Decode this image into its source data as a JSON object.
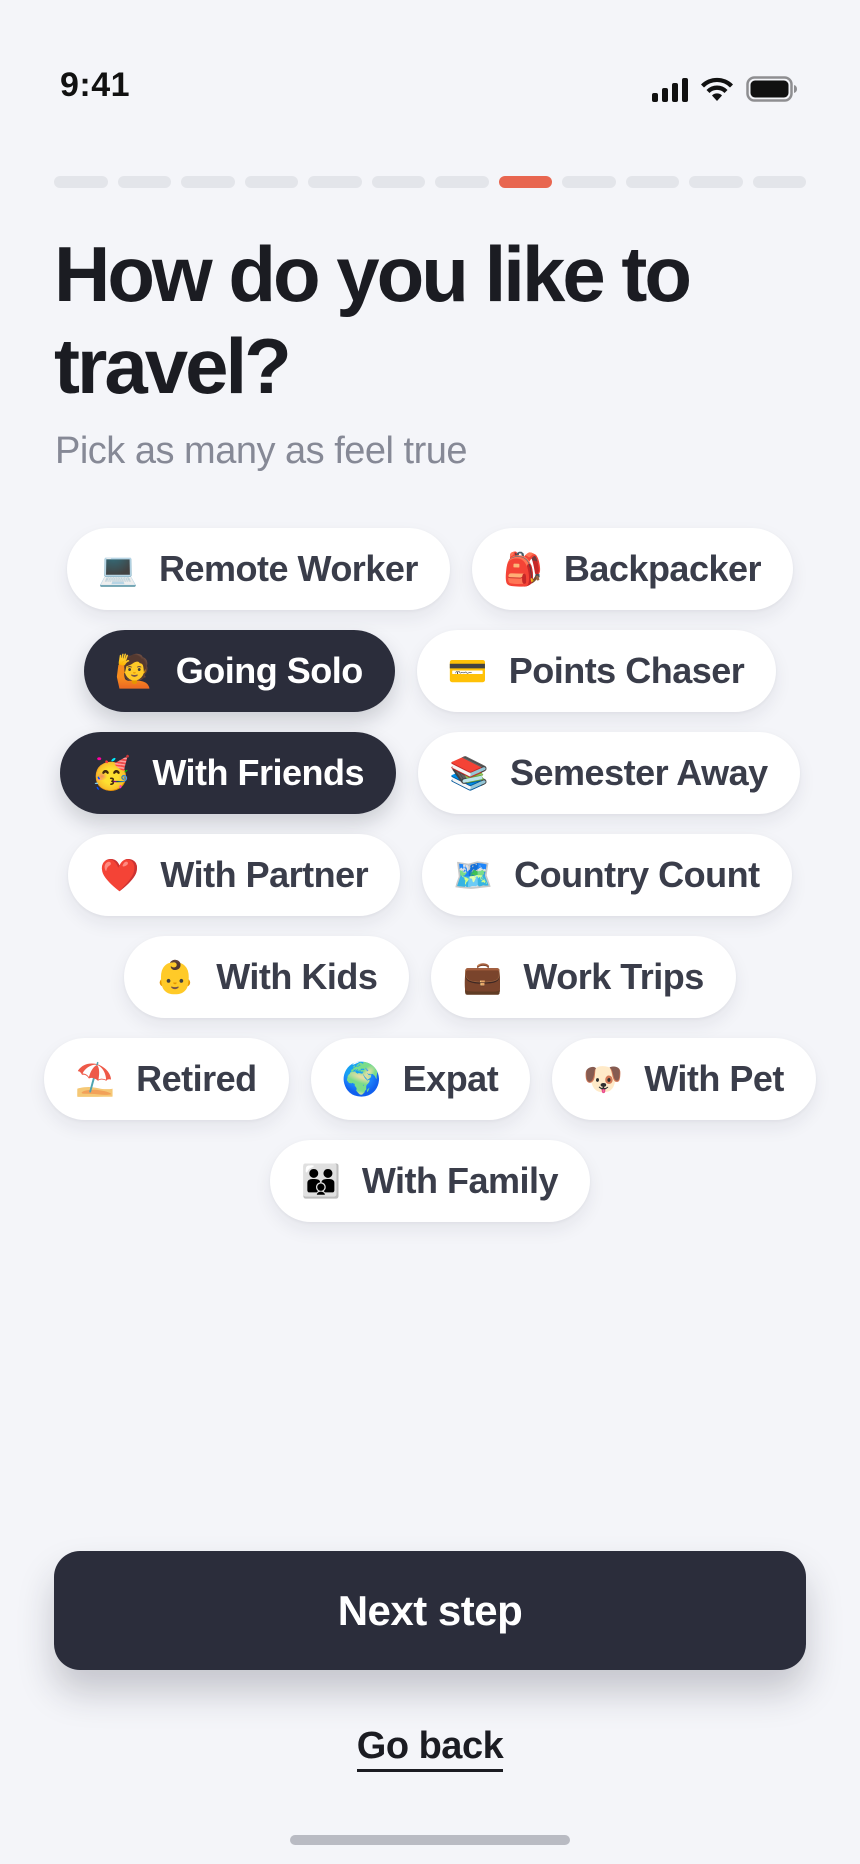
{
  "status_bar": {
    "time": "9:41",
    "icons": [
      "cellular-signal-icon",
      "wifi-icon",
      "battery-icon"
    ]
  },
  "progress": {
    "total_steps": 12,
    "current_step": 8
  },
  "heading": {
    "title": "How do you like to travel?",
    "subtitle": "Pick as many as feel true"
  },
  "colors": {
    "accent": "#e86650",
    "selected_chip": "#2b2d3b",
    "background": "#f4f5f9"
  },
  "options": [
    [
      {
        "emoji": "💻",
        "icon": "laptop-icon",
        "label": "Remote Worker",
        "selected": false
      },
      {
        "emoji": "🎒",
        "icon": "backpack-icon",
        "label": "Backpacker",
        "selected": false
      }
    ],
    [
      {
        "emoji": "🙋",
        "icon": "person-raising-hand-icon",
        "label": "Going Solo",
        "selected": true
      },
      {
        "emoji": "💳",
        "icon": "credit-card-icon",
        "label": "Points Chaser",
        "selected": false
      }
    ],
    [
      {
        "emoji": "🥳",
        "icon": "partying-face-icon",
        "label": "With Friends",
        "selected": true
      },
      {
        "emoji": "📚",
        "icon": "books-icon",
        "label": "Semester Away",
        "selected": false
      }
    ],
    [
      {
        "emoji": "❤️",
        "icon": "heart-icon",
        "label": "With Partner",
        "selected": false
      },
      {
        "emoji": "🗺️",
        "icon": "world-map-icon",
        "label": "Country Count",
        "selected": false
      }
    ],
    [
      {
        "emoji": "👶",
        "icon": "baby-icon",
        "label": "With Kids",
        "selected": false
      },
      {
        "emoji": "💼",
        "icon": "briefcase-icon",
        "label": "Work Trips",
        "selected": false
      }
    ],
    [
      {
        "emoji": "⛱️",
        "icon": "beach-umbrella-icon",
        "label": "Retired",
        "selected": false
      },
      {
        "emoji": "🌍",
        "icon": "globe-icon",
        "label": "Expat",
        "selected": false
      },
      {
        "emoji": "🐶",
        "icon": "dog-face-icon",
        "label": "With Pet",
        "selected": false
      }
    ],
    [
      {
        "emoji": "👪",
        "icon": "family-icon",
        "label": "With Family",
        "selected": false
      }
    ]
  ],
  "actions": {
    "next_label": "Next step",
    "back_label": "Go back"
  }
}
